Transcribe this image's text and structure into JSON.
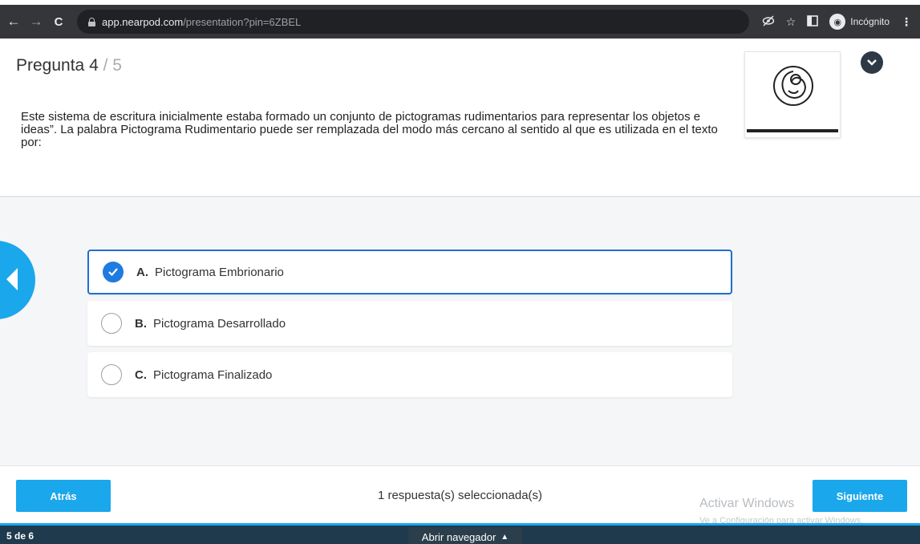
{
  "browser": {
    "url_host": "app.nearpod.com",
    "url_path": "/presentation?pin=6ZBEL",
    "incognito_label": "Incógnito"
  },
  "question": {
    "label": "Pregunta 4",
    "total": " / 5",
    "text": "Este sistema de escritura inicialmente estaba formado un conjunto de pictogramas rudimentarios para representar los objetos e ideas”. La palabra Pictograma Rudimentario puede ser remplazada del modo más cercano al sentido al que es utilizada en el texto por:"
  },
  "options": [
    {
      "letter": "A.",
      "text": "Pictograma Embrionario",
      "selected": true
    },
    {
      "letter": "B.",
      "text": "Pictograma Desarrollado",
      "selected": false
    },
    {
      "letter": "C.",
      "text": "Pictograma Finalizado",
      "selected": false
    }
  ],
  "footer": {
    "back_label": "Atrás",
    "next_label": "Siguiente",
    "status": "1 respuesta(s) seleccionada(s)",
    "watermark_title": "Activar Windows",
    "watermark_sub": "Ve a Configuración para activar Windows."
  },
  "bottombar": {
    "slide_count": "5 de 6",
    "open_browser": "Abrir navegador"
  },
  "colors": {
    "accent": "#1aa7ec",
    "selected_border": "#1f6fd1",
    "bottombar": "#1e3a4c"
  }
}
